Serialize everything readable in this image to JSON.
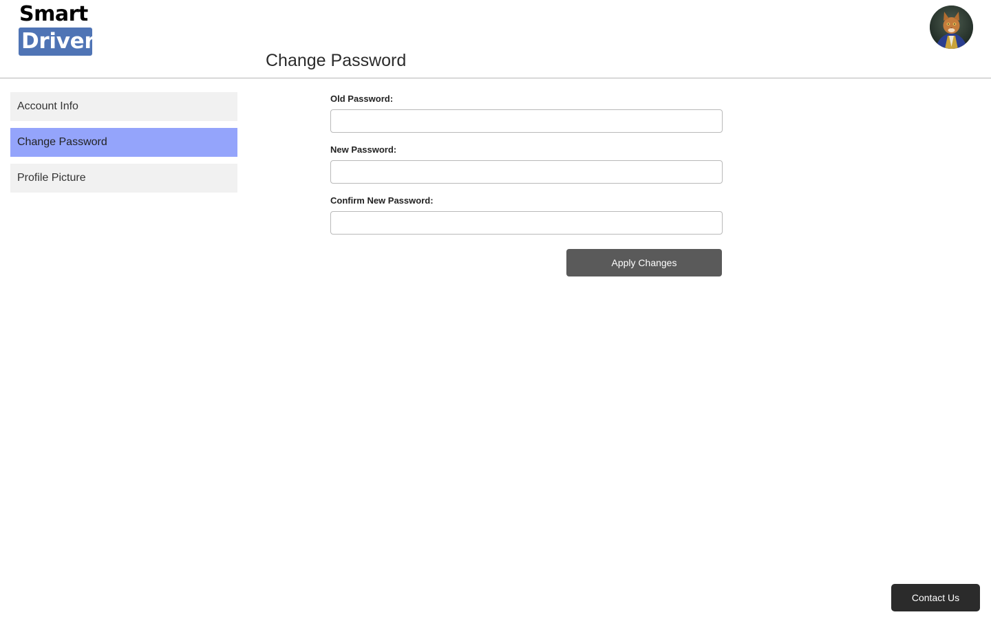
{
  "logo": {
    "line1": "Smart",
    "line2": "Driver",
    "accent_color": "#4f74b5"
  },
  "header": {
    "title": "Change Password",
    "avatar_icon": "cat-portrait-avatar"
  },
  "sidebar": {
    "items": [
      {
        "label": "Account Info",
        "active": false
      },
      {
        "label": "Change Password",
        "active": true
      },
      {
        "label": "Profile Picture",
        "active": false
      }
    ],
    "active_color": "#94a4fb"
  },
  "form": {
    "old_password": {
      "label": "Old Password:",
      "value": "",
      "placeholder": ""
    },
    "new_password": {
      "label": "New Password:",
      "value": "",
      "placeholder": ""
    },
    "confirm_password": {
      "label": "Confirm New Password:",
      "value": "",
      "placeholder": ""
    },
    "apply_label": "Apply Changes"
  },
  "footer": {
    "contact_label": "Contact Us"
  }
}
